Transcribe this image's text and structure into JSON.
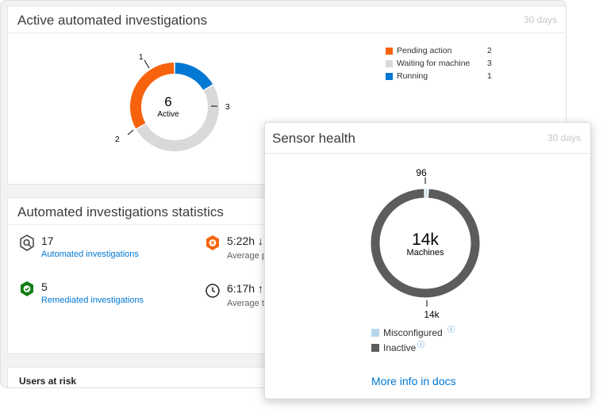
{
  "active_card": {
    "title": "Active automated investigations",
    "range": "30 days",
    "donut": {
      "center_value": "6",
      "center_label": "Active",
      "segments": [
        {
          "name": "Running",
          "value": 1,
          "label": "1",
          "color": "#0078d4"
        },
        {
          "name": "Waiting for machine",
          "value": 3,
          "label": "3",
          "color": "#d9d9d9"
        },
        {
          "name": "Pending action",
          "value": 2,
          "label": "2",
          "color": "#f7630c"
        }
      ]
    },
    "legend": [
      {
        "label": "Pending action",
        "count": "2",
        "color": "#f7630c"
      },
      {
        "label": "Waiting for machine",
        "count": "3",
        "color": "#d9d9d9"
      },
      {
        "label": "Running",
        "count": "1",
        "color": "#0078d4"
      }
    ]
  },
  "stats_card": {
    "title": "Automated investigations statistics",
    "items": [
      {
        "value": "17",
        "label": "Automated investigations",
        "icon": "investigation-icon"
      },
      {
        "value": "5",
        "label": "Remediated investigations",
        "icon": "remediated-shield-icon"
      },
      {
        "value": "5:22h ↓",
        "label": "Average p",
        "icon": "pending-time-icon"
      },
      {
        "value": "6:17h ↑",
        "label": "Average t",
        "icon": "clock-icon"
      }
    ]
  },
  "users_card": {
    "title": "Users at risk"
  },
  "sensor_card": {
    "title": "Sensor health",
    "range": "30 days",
    "donut": {
      "center_value": "14k",
      "center_label": "Machines",
      "segments": [
        {
          "name": "Misconfigured",
          "value": 96,
          "label": "96",
          "color": "#b4d6ee"
        },
        {
          "name": "Inactive",
          "value": 14000,
          "label": "14k",
          "color": "#5c5c5c"
        }
      ]
    },
    "legend": [
      {
        "label": "Misconfigured",
        "color": "#b4d6ee",
        "info_icon": "info-icon"
      },
      {
        "label": "Inactive",
        "color": "#5c5c5c",
        "info_icon": "info-icon"
      }
    ],
    "link": "More info in docs"
  }
}
